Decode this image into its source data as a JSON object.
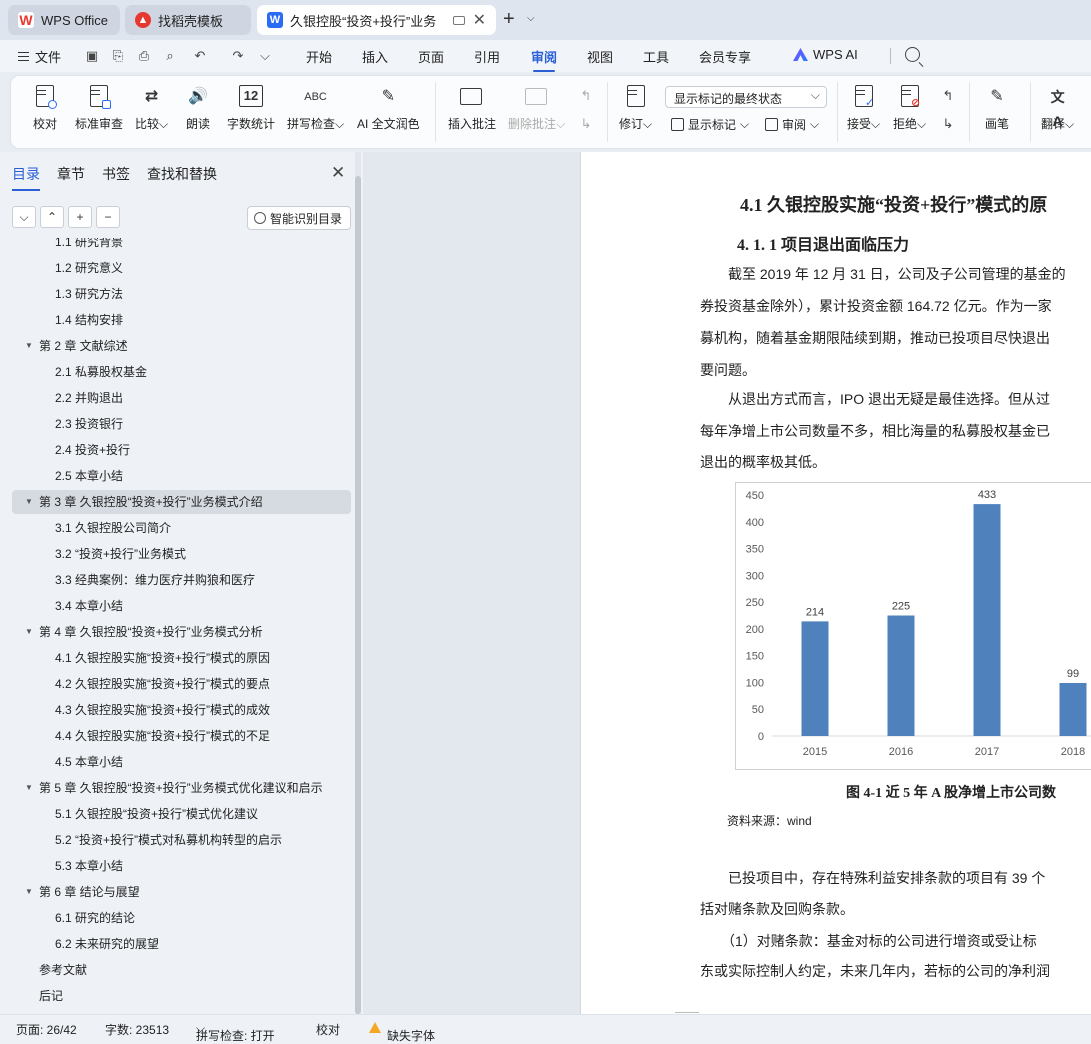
{
  "tabs": {
    "wps_office": "WPS Office",
    "daoke": "找稻壳模板",
    "document": "久银控股“投资+投行”业务"
  },
  "menu": {
    "file": "文件",
    "items": [
      "开始",
      "插入",
      "页面",
      "引用",
      "审阅",
      "视图",
      "工具",
      "会员专享"
    ],
    "active": "审阅",
    "wps_ai": "WPS AI"
  },
  "ribbon": {
    "proofread": "校对",
    "standard_review": "标准审查",
    "compare": "比较",
    "read_aloud": "朗读",
    "word_count": "字数统计",
    "spell_check": "拼写检查",
    "ai_polish": "AI 全文润色",
    "insert_comment": "插入批注",
    "delete_comment": "删除批注",
    "track_changes": "修订",
    "markup_select": "显示标记的最终状态",
    "show_markup": "显示标记",
    "review": "审阅",
    "accept": "接受",
    "reject": "拒绝",
    "draw": "画笔",
    "translate": "翻译",
    "word_count_icon_text": "12",
    "spell_icon_text": "ABC"
  },
  "nav": {
    "tabs": [
      "目录",
      "章节",
      "书签",
      "查找和替换"
    ],
    "active_tab": "目录",
    "smart_toc": "智能识别目录",
    "toc": [
      {
        "level": 2,
        "text": "1.1  研究背景"
      },
      {
        "level": 2,
        "text": "1.2  研究意义"
      },
      {
        "level": 2,
        "text": "1.3  研究方法"
      },
      {
        "level": 2,
        "text": "1.4  结构安排"
      },
      {
        "level": 1,
        "text": "第 2 章  文献综述"
      },
      {
        "level": 2,
        "text": "2.1  私募股权基金"
      },
      {
        "level": 2,
        "text": "2.2  并购退出"
      },
      {
        "level": 2,
        "text": "2.3  投资银行"
      },
      {
        "level": 2,
        "text": "2.4  投资+投行"
      },
      {
        "level": 2,
        "text": "2.5  本章小结"
      },
      {
        "level": 1,
        "text": "第 3 章  久银控股“投资+投行”业务模式介绍",
        "selected": true
      },
      {
        "level": 2,
        "text": "3.1  久银控股公司简介"
      },
      {
        "level": 2,
        "text": "3.2  “投资+投行”业务模式"
      },
      {
        "level": 2,
        "text": "3.3  经典案例：维力医疗并购狼和医疗"
      },
      {
        "level": 2,
        "text": "3.4  本章小结"
      },
      {
        "level": 1,
        "text": "第 4 章  久银控股“投资+投行”业务模式分析"
      },
      {
        "level": 2,
        "text": "4.1  久银控股实施“投资+投行”模式的原因"
      },
      {
        "level": 2,
        "text": "4.2  久银控股实施“投资+投行”模式的要点"
      },
      {
        "level": 2,
        "text": "4.3  久银控股实施“投资+投行”模式的成效"
      },
      {
        "level": 2,
        "text": "4.4  久银控股实施“投资+投行”模式的不足"
      },
      {
        "level": 2,
        "text": "4.5  本章小结"
      },
      {
        "level": 1,
        "text": "第 5 章  久银控股“投资+投行”业务模式优化建议和启示"
      },
      {
        "level": 2,
        "text": "5.1  久银控股“投资+投行”模式优化建议"
      },
      {
        "level": 2,
        "text": "5.2  “投资+投行”模式对私募机构转型的启示"
      },
      {
        "level": 2,
        "text": "5.3  本章小结"
      },
      {
        "level": 1,
        "text": "第 6 章  结论与展望"
      },
      {
        "level": 2,
        "text": "6.1  研究的结论"
      },
      {
        "level": 2,
        "text": "6.2  未来研究的展望"
      },
      {
        "level": 0,
        "text": "参考文献"
      },
      {
        "level": 0,
        "text": "后记"
      }
    ]
  },
  "document": {
    "heading2": "4.1  久银控股实施“投资+投行”模式的原",
    "heading3": "4. 1. 1  项目退出面临压力",
    "paragraphs": [
      "　　截至 2019 年 12 月 31 日，公司及子公司管理的基金的",
      "券投资基金除外），累计投资金额 164.72 亿元。作为一家",
      "募机构，随着基金期限陆续到期，推动已投项目尽快退出",
      "要问题。",
      "　　从退出方式而言，IPO 退出无疑是最佳选择。但从过",
      "每年净增上市公司数量不多，相比海量的私募股权基金已",
      "退出的概率极其低。"
    ],
    "caption": "图 4-1  近 5 年 A 股净增上市公司数",
    "source": "资料来源：wind",
    "paragraphs2": [
      "　　已投项目中，存在特殊利益安排条款的项目有 39 个",
      "括对赌条款及回购条款。",
      "　　（1）对赌条款：基金对标的公司进行增资或受让标",
      "东或实际控制人约定，未来几年内，若标的公司的净利润"
    ]
  },
  "chart_data": {
    "type": "bar",
    "categories": [
      "2015",
      "2016",
      "2017",
      "2018"
    ],
    "values": [
      214,
      225,
      433,
      99
    ],
    "ylim": [
      0,
      450
    ],
    "yticks": [
      0,
      50,
      100,
      150,
      200,
      250,
      300,
      350,
      400,
      450
    ],
    "bar_color": "#4f81bd",
    "grid": false,
    "title": "",
    "xlabel": "",
    "ylabel": ""
  },
  "status": {
    "page": "页面: 26/42",
    "words": "字数: 23513",
    "spell": "拼写检查: 打开",
    "proofread": "校对",
    "missing_font": "缺失字体"
  },
  "colors": {
    "accent": "#2a5fd8",
    "wps_red": "#e8372f",
    "doc_blue": "#2a6df4",
    "warning": "#f5a623"
  }
}
